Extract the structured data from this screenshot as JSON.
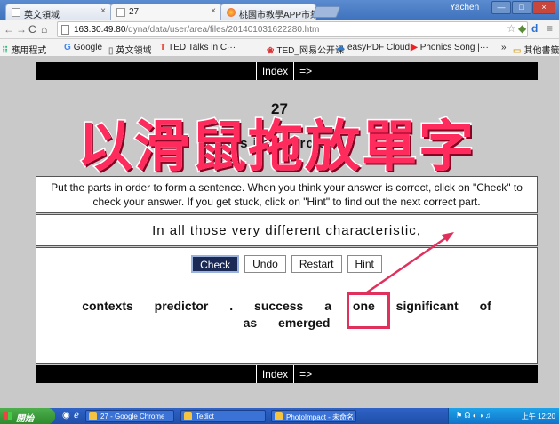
{
  "browser": {
    "tabs": [
      {
        "label": "英文領域",
        "icon": "page-icon"
      },
      {
        "label": "27",
        "icon": "page-icon"
      },
      {
        "label": "桃園市教學APP市集 ×",
        "icon": "colorful-icon"
      }
    ],
    "user": "Yachen",
    "window_buttons": [
      "—",
      "□",
      "×"
    ],
    "url_host": "163.30.49.80",
    "url_path": "/dyna/data/user/area/files/201401031622280.htm",
    "bookmarks": [
      {
        "label": "應用程式",
        "icon": "apps-icon"
      },
      {
        "label": "Google",
        "icon": "google-icon"
      },
      {
        "label": "英文領域",
        "icon": "page-icon"
      },
      {
        "label": "TED Talks in C···",
        "icon": "ted-icon"
      },
      {
        "label": "TED_网易公开课",
        "icon": "netease-icon"
      },
      {
        "label": "easyPDF Cloud",
        "icon": "cloud-icon"
      },
      {
        "label": "Phonics Song |···",
        "icon": "youtube-icon"
      },
      {
        "label": "»",
        "icon": ""
      },
      {
        "label": "其他書籤",
        "icon": "folder-icon"
      }
    ]
  },
  "page": {
    "nav_top": {
      "index": "Index",
      "next": "=>"
    },
    "nav_bottom": {
      "index": "Index",
      "next": "=>"
    },
    "exercise_number": "27",
    "exercise_name_visible": "M   s   i   c   exercise",
    "overlay_caption": "以滑鼠拖放單字",
    "instructions": "Put the parts in order to form a sentence. When you think your answer is correct, click on \"Check\" to check your answer. If you get stuck, click on \"Hint\" to find out the next correct part.",
    "answer_text": "In all those very different characteristic,",
    "buttons": {
      "check": "Check",
      "undo": "Undo",
      "restart": "Restart",
      "hint": "Hint"
    },
    "words_line1": [
      "contexts",
      "predictor",
      ".",
      "success",
      "a",
      "one",
      "significant",
      "of"
    ],
    "words_line2": [
      "as",
      "emerged"
    ],
    "highlight_color": "#e0315d"
  },
  "taskbar": {
    "start": "開始",
    "tasks": [
      "27 - Google Chrome",
      "Tedict",
      "PhotoImpact - 未命名"
    ],
    "clock": "上午 12:20"
  }
}
